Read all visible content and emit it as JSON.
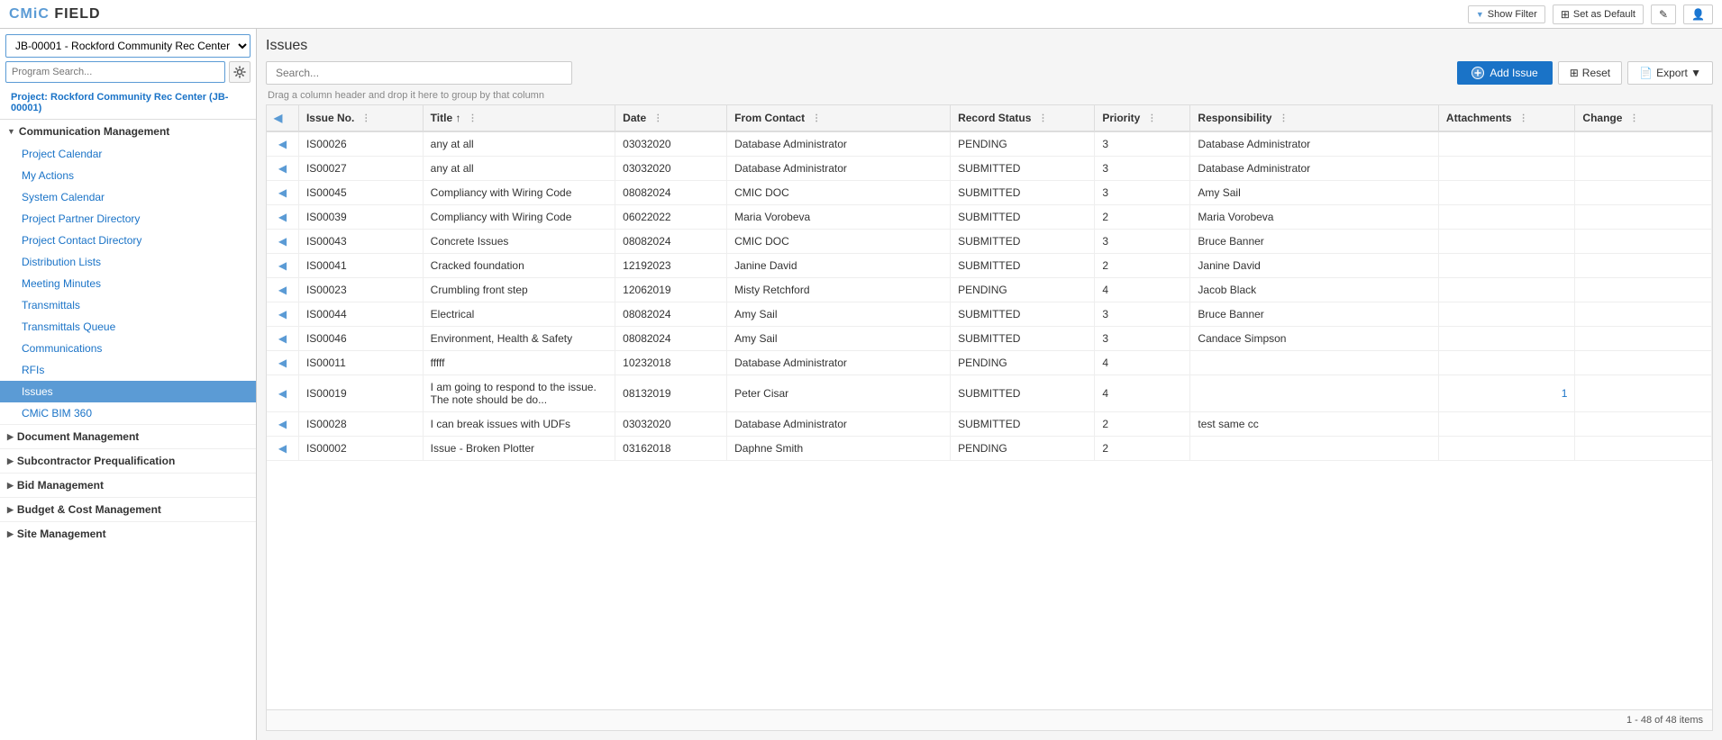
{
  "app": {
    "logo_text": "CMiC FIELD",
    "top_bar": {
      "show_filter_label": "Show Filter",
      "set_as_default_label": "Set as Default"
    }
  },
  "sidebar": {
    "project_select_value": "JB-00001 - Rockford Community Rec Center",
    "search_placeholder": "Program Search...",
    "project_link": "Project: Rockford Community Rec Center (JB-00001)",
    "sections": [
      {
        "id": "communication-management",
        "label": "Communication Management",
        "expanded": true,
        "items": [
          {
            "id": "project-calendar",
            "label": "Project Calendar",
            "active": false
          },
          {
            "id": "my-actions",
            "label": "My Actions",
            "active": false
          },
          {
            "id": "system-calendar",
            "label": "System Calendar",
            "active": false
          },
          {
            "id": "project-partner-directory",
            "label": "Project Partner Directory",
            "active": false
          },
          {
            "id": "project-contact-directory",
            "label": "Project Contact Directory",
            "active": false
          },
          {
            "id": "distribution-lists",
            "label": "Distribution Lists",
            "active": false
          },
          {
            "id": "meeting-minutes",
            "label": "Meeting Minutes",
            "active": false
          },
          {
            "id": "transmittals",
            "label": "Transmittals",
            "active": false
          },
          {
            "id": "transmittals-queue",
            "label": "Transmittals Queue",
            "active": false
          },
          {
            "id": "communications",
            "label": "Communications",
            "active": false
          },
          {
            "id": "rfis",
            "label": "RFIs",
            "active": false
          },
          {
            "id": "issues",
            "label": "Issues",
            "active": true
          },
          {
            "id": "cmic-bim-360",
            "label": "CMiC BIM 360",
            "active": false
          }
        ]
      },
      {
        "id": "document-management",
        "label": "Document Management",
        "expanded": false,
        "items": []
      },
      {
        "id": "subcontractor-prequalification",
        "label": "Subcontractor Prequalification",
        "expanded": false,
        "items": []
      },
      {
        "id": "bid-management",
        "label": "Bid Management",
        "expanded": false,
        "items": []
      },
      {
        "id": "budget-cost-management",
        "label": "Budget & Cost Management",
        "expanded": false,
        "items": []
      },
      {
        "id": "site-management",
        "label": "Site Management",
        "expanded": false,
        "items": []
      }
    ]
  },
  "content": {
    "page_title": "Issues",
    "search_placeholder": "Search...",
    "drag_hint": "Drag a column header and drop it here to group by that column",
    "toolbar": {
      "add_issue_label": "Add Issue",
      "reset_label": "Reset",
      "export_label": "Export ▼"
    },
    "table": {
      "columns": [
        {
          "id": "expand",
          "label": "",
          "width": "20"
        },
        {
          "id": "issue-no",
          "label": "Issue No.",
          "sort": "none",
          "width": "90"
        },
        {
          "id": "title",
          "label": "Title",
          "sort": "asc",
          "width": "150"
        },
        {
          "id": "date",
          "label": "Date",
          "sort": "none",
          "width": "90"
        },
        {
          "id": "from-contact",
          "label": "From Contact",
          "sort": "none",
          "width": "180"
        },
        {
          "id": "record-status",
          "label": "Record Status",
          "sort": "none",
          "width": "110"
        },
        {
          "id": "priority",
          "label": "Priority",
          "sort": "none",
          "width": "70"
        },
        {
          "id": "responsibility",
          "label": "Responsibility",
          "sort": "none",
          "width": "200"
        },
        {
          "id": "attachments",
          "label": "Attachments",
          "sort": "none",
          "width": "100"
        },
        {
          "id": "change",
          "label": "Change",
          "sort": "none",
          "width": "100"
        }
      ],
      "rows": [
        {
          "issue_no": "IS00026",
          "title": "any at all",
          "date": "03032020",
          "from_contact": "Database Administrator",
          "record_status": "PENDING",
          "priority": "3",
          "responsibility": "Database Administrator",
          "attachments": "",
          "change": ""
        },
        {
          "issue_no": "IS00027",
          "title": "any at all",
          "date": "03032020",
          "from_contact": "Database Administrator",
          "record_status": "SUBMITTED",
          "priority": "3",
          "responsibility": "Database Administrator",
          "attachments": "",
          "change": ""
        },
        {
          "issue_no": "IS00045",
          "title": "Compliancy with Wiring Code",
          "date": "08082024",
          "from_contact": "CMIC DOC",
          "record_status": "SUBMITTED",
          "priority": "3",
          "responsibility": "Amy Sail",
          "attachments": "",
          "change": ""
        },
        {
          "issue_no": "IS00039",
          "title": "Compliancy with Wiring Code",
          "date": "06022022",
          "from_contact": "Maria Vorobeva",
          "record_status": "SUBMITTED",
          "priority": "2",
          "responsibility": "Maria Vorobeva",
          "attachments": "",
          "change": ""
        },
        {
          "issue_no": "IS00043",
          "title": "Concrete Issues",
          "date": "08082024",
          "from_contact": "CMIC DOC",
          "record_status": "SUBMITTED",
          "priority": "3",
          "responsibility": "Bruce Banner",
          "attachments": "",
          "change": ""
        },
        {
          "issue_no": "IS00041",
          "title": "Cracked foundation",
          "date": "12192023",
          "from_contact": "Janine David",
          "record_status": "SUBMITTED",
          "priority": "2",
          "responsibility": "Janine David",
          "attachments": "",
          "change": ""
        },
        {
          "issue_no": "IS00023",
          "title": "Crumbling front step",
          "date": "12062019",
          "from_contact": "Misty Retchford",
          "record_status": "PENDING",
          "priority": "4",
          "responsibility": "Jacob Black",
          "attachments": "",
          "change": ""
        },
        {
          "issue_no": "IS00044",
          "title": "Electrical",
          "date": "08082024",
          "from_contact": "Amy Sail",
          "record_status": "SUBMITTED",
          "priority": "3",
          "responsibility": "Bruce Banner",
          "attachments": "",
          "change": ""
        },
        {
          "issue_no": "IS00046",
          "title": "Environment, Health & Safety",
          "date": "08082024",
          "from_contact": "Amy Sail",
          "record_status": "SUBMITTED",
          "priority": "3",
          "responsibility": "Candace Simpson",
          "attachments": "",
          "change": ""
        },
        {
          "issue_no": "IS00011",
          "title": "fffff",
          "date": "10232018",
          "from_contact": "Database Administrator",
          "record_status": "PENDING",
          "priority": "4",
          "responsibility": "",
          "attachments": "",
          "change": ""
        },
        {
          "issue_no": "IS00019",
          "title": "I am going to respond to the issue. The note should be do...",
          "date": "08132019",
          "from_contact": "Peter Cisar",
          "record_status": "SUBMITTED",
          "priority": "4",
          "responsibility": "",
          "attachments": "1",
          "change": ""
        },
        {
          "issue_no": "IS00028",
          "title": "I can break issues with UDFs",
          "date": "03032020",
          "from_contact": "Database Administrator",
          "record_status": "SUBMITTED",
          "priority": "2",
          "responsibility": "test same cc",
          "attachments": "",
          "change": ""
        },
        {
          "issue_no": "IS00002",
          "title": "Issue - Broken Plotter",
          "date": "03162018",
          "from_contact": "Daphne Smith",
          "record_status": "PENDING",
          "priority": "2",
          "responsibility": "",
          "attachments": "",
          "change": ""
        }
      ],
      "footer": "1 - 48 of 48 items"
    }
  }
}
